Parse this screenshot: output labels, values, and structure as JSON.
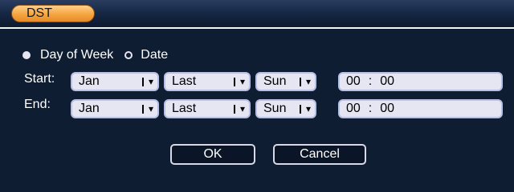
{
  "window": {
    "title": "DST"
  },
  "mode": {
    "options": [
      {
        "label": "Day of Week",
        "selected": true
      },
      {
        "label": "Date",
        "selected": false
      }
    ]
  },
  "start": {
    "label": "Start:",
    "month": "Jan",
    "week": "Last",
    "day": "Sun",
    "hour": "00",
    "minute": "00"
  },
  "end": {
    "label": "End:",
    "month": "Jan",
    "week": "Last",
    "day": "Sun",
    "hour": "00",
    "minute": "00"
  },
  "buttons": {
    "ok": "OK",
    "cancel": "Cancel"
  },
  "glyphs": {
    "caret": "▾",
    "colon": ":"
  },
  "colors": {
    "background": "#0f1d33",
    "tab": "#f5a540",
    "field": "#e6e6f2",
    "field_border": "#b8c0e6"
  }
}
